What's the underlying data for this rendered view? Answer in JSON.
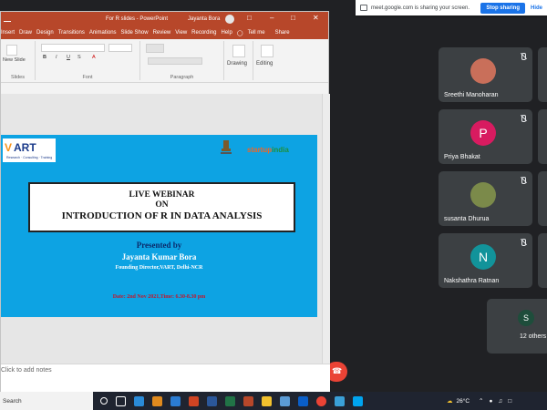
{
  "share_bar": {
    "message": "meet.google.com is sharing your screen.",
    "stop_label": "Stop sharing",
    "hide_label": "Hide"
  },
  "ppt": {
    "window_title": "For R slides  -  PowerPoint",
    "user": "Jayanta Bora",
    "menu": [
      "Insert",
      "Draw",
      "Design",
      "Transitions",
      "Animations",
      "Slide Show",
      "Review",
      "View",
      "Recording",
      "Help"
    ],
    "tell_me": "Tell me",
    "share": "Share",
    "groups": {
      "slides": "Slides",
      "font": "Font",
      "paragraph": "Paragraph",
      "drawing": "Drawing",
      "editing": "Editing"
    },
    "new_slide": "New Slide",
    "notes_placeholder": "Click to add notes"
  },
  "slide": {
    "logo_v": "V",
    "logo_art": "ART",
    "logo_tagline": "Research · Consulting · Training",
    "startup_a": "startup",
    "startup_b": "india",
    "title_l1": "LIVE WEBINAR",
    "title_l2": "ON",
    "title_l3": "INTRODUCTION OF R IN DATA ANALYSIS",
    "presented_by": "Presented by",
    "presenter": "Jayanta Kumar Bora",
    "role": "Founding Director,VART, Delhi-NCR",
    "date": "Date: 2nd Nov 2021,Time: 6.30-8.30 pm"
  },
  "participants": [
    {
      "name": "Sreethi Manoharan",
      "initial": "",
      "color": "#c96f5a"
    },
    {
      "name": "Priya Bhakat",
      "initial": "P",
      "color": "#d81b60"
    },
    {
      "name": "susanta Dhurua",
      "initial": "",
      "color": "#7b8a4a"
    },
    {
      "name": "Nakshathra Ratnan",
      "initial": "N",
      "color": "#12939a"
    }
  ],
  "others": {
    "initial": "S",
    "label": "12 others"
  },
  "taskbar": {
    "search": "Search",
    "temp": "26°C"
  },
  "colors": {
    "ppt_accent": "#b7472a",
    "meet_bg": "#202124",
    "tile_bg": "#3c4043",
    "slide_bg": "#0da3e3"
  }
}
